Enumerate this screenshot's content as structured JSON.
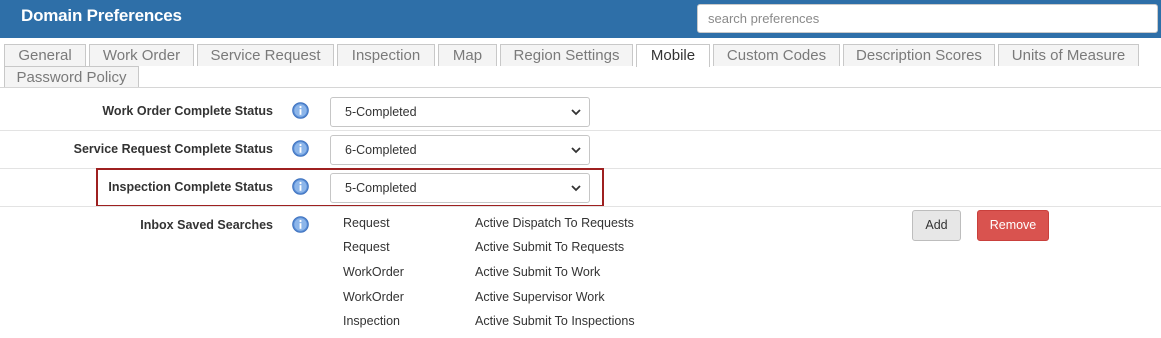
{
  "header": {
    "title": "Domain Preferences",
    "search_placeholder": "search preferences"
  },
  "tabs": [
    {
      "label": "General"
    },
    {
      "label": "Work Order"
    },
    {
      "label": "Service Request"
    },
    {
      "label": "Inspection"
    },
    {
      "label": "Map"
    },
    {
      "label": "Region Settings"
    },
    {
      "label": "Mobile",
      "active": true
    },
    {
      "label": "Custom Codes"
    },
    {
      "label": "Description Scores"
    },
    {
      "label": "Units of Measure"
    },
    {
      "label": "Password Policy"
    }
  ],
  "form": {
    "work_order_status": {
      "label": "Work Order Complete Status",
      "value": "5-Completed"
    },
    "service_request_status": {
      "label": "Service Request Complete Status",
      "value": "6-Completed"
    },
    "inspection_status": {
      "label": "Inspection Complete Status",
      "value": "5-Completed"
    },
    "inbox_saved_searches": {
      "label": "Inbox Saved Searches",
      "items": [
        {
          "type": "Request",
          "name": "Active Dispatch To Requests"
        },
        {
          "type": "Request",
          "name": "Active Submit To Requests"
        },
        {
          "type": "WorkOrder",
          "name": "Active Submit To Work"
        },
        {
          "type": "WorkOrder",
          "name": "Active Supervisor Work"
        },
        {
          "type": "Inspection",
          "name": "Active Submit To Inspections"
        }
      ],
      "add_label": "Add",
      "remove_label": "Remove"
    }
  },
  "colors": {
    "header_bg": "#2e6fa8",
    "remove_button": "#d9534f",
    "highlight_border": "#9e2020",
    "info_icon": "#5b8fd6"
  },
  "icons": {
    "info": "info-icon",
    "select_chevron": "chevron-down-icon"
  }
}
